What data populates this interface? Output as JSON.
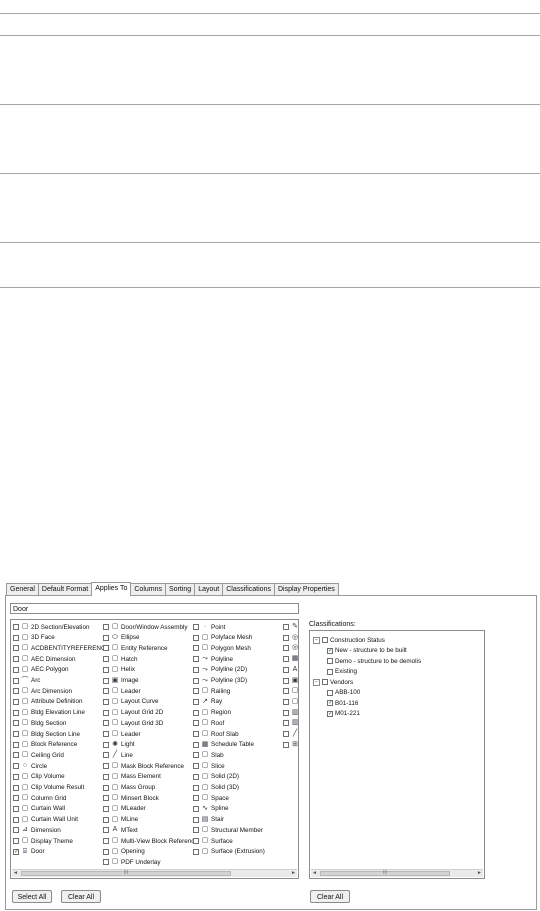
{
  "tabs": [
    "General",
    "Default Format",
    "Applies To",
    "Columns",
    "Sorting",
    "Layout",
    "Classifications",
    "Display Properties"
  ],
  "active_tab": "Applies To",
  "filter_value": "Door",
  "columns": [
    [
      {
        "label": "2D Section/Elevation",
        "icon": "2d-section-icon",
        "checked": false
      },
      {
        "label": "3D Face",
        "icon": "3d-face-icon",
        "checked": false
      },
      {
        "label": "ACDBENTITYREFERENCE",
        "icon": "entity-reference-icon",
        "checked": false
      },
      {
        "label": "AEC Dimension",
        "icon": "aec-dimension-icon",
        "checked": false
      },
      {
        "label": "AEC Polygon",
        "icon": "aec-polygon-icon",
        "checked": false
      },
      {
        "label": "Arc",
        "icon": "arc-icon",
        "checked": false
      },
      {
        "label": "Arc Dimension",
        "icon": "arc-dimension-icon",
        "checked": false
      },
      {
        "label": "Attribute Definition",
        "icon": "attribute-definition-icon",
        "checked": false
      },
      {
        "label": "Bldg Elevation Line",
        "icon": "bldg-elevation-line-icon",
        "checked": false
      },
      {
        "label": "Bldg Section",
        "icon": "bldg-section-icon",
        "checked": false
      },
      {
        "label": "Bldg Section Line",
        "icon": "bldg-section-line-icon",
        "checked": false
      },
      {
        "label": "Block Reference",
        "icon": "block-reference-icon",
        "checked": false
      },
      {
        "label": "Ceiling Grid",
        "icon": "ceiling-grid-icon",
        "checked": false
      },
      {
        "label": "Circle",
        "icon": "circle-icon",
        "checked": false
      },
      {
        "label": "Clip Volume",
        "icon": "clip-volume-icon",
        "checked": false
      },
      {
        "label": "Clip Volume Result",
        "icon": "clip-volume-result-icon",
        "checked": false
      },
      {
        "label": "Column Grid",
        "icon": "column-grid-icon",
        "checked": false
      },
      {
        "label": "Curtain Wall",
        "icon": "curtain-wall-icon",
        "checked": false
      },
      {
        "label": "Curtain Wall Unit",
        "icon": "curtain-wall-unit-icon",
        "checked": false
      },
      {
        "label": "Dimension",
        "icon": "dimension-icon",
        "checked": false
      },
      {
        "label": "Display Theme",
        "icon": "display-theme-icon",
        "checked": false
      },
      {
        "label": "Door",
        "icon": "door-icon",
        "checked": true
      }
    ],
    [
      {
        "label": "Door/Window Assembly",
        "icon": "door-window-assembly-icon",
        "checked": false
      },
      {
        "label": "Ellipse",
        "icon": "ellipse-icon",
        "checked": false
      },
      {
        "label": "Entity Reference",
        "icon": "entity-reference-icon",
        "checked": false
      },
      {
        "label": "Hatch",
        "icon": "hatch-icon",
        "checked": false
      },
      {
        "label": "Helix",
        "icon": "helix-icon",
        "checked": false
      },
      {
        "label": "Image",
        "icon": "image-icon",
        "checked": false
      },
      {
        "label": "Leader",
        "icon": "leader-icon",
        "checked": false
      },
      {
        "label": "Layout Curve",
        "icon": "layout-curve-icon",
        "checked": false
      },
      {
        "label": "Layout Grid 2D",
        "icon": "layout-grid-2d-icon",
        "checked": false
      },
      {
        "label": "Layout Grid 3D",
        "icon": "layout-grid-3d-icon",
        "checked": false
      },
      {
        "label": "Leader",
        "icon": "leader-icon",
        "checked": false
      },
      {
        "label": "Light",
        "icon": "light-icon",
        "checked": false
      },
      {
        "label": "Line",
        "icon": "line-icon",
        "checked": false
      },
      {
        "label": "Mask Block Reference",
        "icon": "mask-block-reference-icon",
        "checked": false
      },
      {
        "label": "Mass Element",
        "icon": "mass-element-icon",
        "checked": false
      },
      {
        "label": "Mass Group",
        "icon": "mass-group-icon",
        "checked": false
      },
      {
        "label": "Minsert Block",
        "icon": "minsert-block-icon",
        "checked": false
      },
      {
        "label": "MLeader",
        "icon": "mleader-icon",
        "checked": false
      },
      {
        "label": "MLine",
        "icon": "mline-icon",
        "checked": false
      },
      {
        "label": "MText",
        "icon": "mtext-icon",
        "checked": false
      },
      {
        "label": "Multi-View Block Reference",
        "icon": "multi-view-block-icon",
        "checked": false
      },
      {
        "label": "Opening",
        "icon": "opening-icon",
        "checked": false
      },
      {
        "label": "PDF Underlay",
        "icon": "pdf-underlay-icon",
        "checked": false
      }
    ],
    [
      {
        "label": "Point",
        "icon": "point-icon",
        "checked": false
      },
      {
        "label": "Polyface Mesh",
        "icon": "polyface-mesh-icon",
        "checked": false
      },
      {
        "label": "Polygon Mesh",
        "icon": "polygon-mesh-icon",
        "checked": false
      },
      {
        "label": "Polyline",
        "icon": "polyline-icon",
        "checked": false
      },
      {
        "label": "Polyline (2D)",
        "icon": "polyline-2d-icon",
        "checked": false
      },
      {
        "label": "Polyline (3D)",
        "icon": "polyline-3d-icon",
        "checked": false
      },
      {
        "label": "Railing",
        "icon": "railing-icon",
        "checked": false
      },
      {
        "label": "Ray",
        "icon": "ray-icon",
        "checked": false
      },
      {
        "label": "Region",
        "icon": "region-icon",
        "checked": false
      },
      {
        "label": "Roof",
        "icon": "roof-icon",
        "checked": false
      },
      {
        "label": "Roof Slab",
        "icon": "roof-slab-icon",
        "checked": false
      },
      {
        "label": "Schedule Table",
        "icon": "schedule-table-icon",
        "checked": false
      },
      {
        "label": "Slab",
        "icon": "slab-icon",
        "checked": false
      },
      {
        "label": "Slice",
        "icon": "slice-icon",
        "checked": false
      },
      {
        "label": "Solid (2D)",
        "icon": "solid-2d-icon",
        "checked": false
      },
      {
        "label": "Solid (3D)",
        "icon": "solid-3d-icon",
        "checked": false
      },
      {
        "label": "Space",
        "icon": "space-icon",
        "checked": false
      },
      {
        "label": "Spline",
        "icon": "spline-icon",
        "checked": false
      },
      {
        "label": "Stair",
        "icon": "stair-icon",
        "checked": false
      },
      {
        "label": "Structural Member",
        "icon": "structural-member-icon",
        "checked": false
      },
      {
        "label": "Surface",
        "icon": "surface-icon",
        "checked": false
      },
      {
        "label": "Surface (Extrusion)",
        "icon": "surface-extrusion-icon",
        "checked": false
      }
    ],
    [
      {
        "label": "",
        "icon": "pencil-icon",
        "checked": false
      },
      {
        "label": "",
        "icon": "globe-icon",
        "checked": false
      },
      {
        "label": "",
        "icon": "globe-icon",
        "checked": false
      },
      {
        "label": "",
        "icon": "table-icon",
        "checked": false
      },
      {
        "label": "",
        "icon": "text-icon",
        "checked": false
      },
      {
        "label": "",
        "icon": "image-icon",
        "checked": false
      },
      {
        "label": "",
        "icon": "vertex-icon",
        "checked": false
      },
      {
        "label": "",
        "icon": "view-icon",
        "checked": false
      },
      {
        "label": "",
        "icon": "wall-icon",
        "checked": false
      },
      {
        "label": "",
        "icon": "wall-icon",
        "checked": false
      },
      {
        "label": "",
        "icon": "line-icon",
        "checked": false
      },
      {
        "label": "",
        "icon": "window-icon",
        "checked": false
      }
    ]
  ],
  "buttons": {
    "select_all": "Select All",
    "clear_all": "Clear All",
    "tree_clear_all": "Clear All"
  },
  "classifications": {
    "label": "Classifications:",
    "tree": [
      {
        "label": "Construction Status",
        "level": 0,
        "expander": "−",
        "checked": false
      },
      {
        "label": "New - structure to be built",
        "level": 1,
        "checked": true
      },
      {
        "label": "Demo - structure to be demolis",
        "level": 1,
        "checked": false
      },
      {
        "label": "Existing",
        "level": 1,
        "checked": false
      },
      {
        "label": "Vendors",
        "level": 0,
        "expander": "−",
        "checked": false
      },
      {
        "label": "ABB-100",
        "level": 1,
        "checked": false
      },
      {
        "label": "B01-116",
        "level": 1,
        "checked": true
      },
      {
        "label": "M01-221",
        "level": 1,
        "checked": true
      }
    ]
  },
  "scroll_thumb_glyph": "III",
  "scroll_left": "◄",
  "scroll_right": "►",
  "checkmark": "✓"
}
